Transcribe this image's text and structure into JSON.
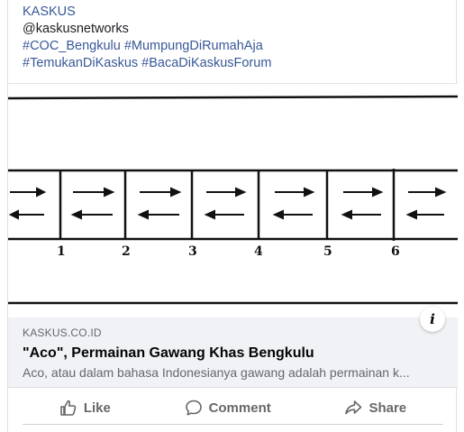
{
  "post": {
    "author_link": "KASKUS",
    "handle": "@kaskusnetworks",
    "hashtags_line1": [
      "#COC_Bengkulu",
      "#MumpungDiRumahAja"
    ],
    "hashtags_line2": [
      "#TemukanDiKaskus",
      "#BacaDiKaskusForum"
    ]
  },
  "diagram": {
    "numbers": [
      "1",
      "2",
      "3",
      "4",
      "5",
      "6"
    ]
  },
  "preview": {
    "domain": "KASKUS.CO.ID",
    "title": "\"Aco\", Permainan Gawang Khas Bengkulu",
    "description": "Aco, atau dalam bahasa Indonesianya gawang adalah permainan k...",
    "info_icon": "info-icon"
  },
  "actions": {
    "like": "Like",
    "comment": "Comment",
    "share": "Share"
  },
  "colors": {
    "link": "#385898",
    "muted": "#65676b",
    "preview_bg": "#f0f2f5"
  }
}
